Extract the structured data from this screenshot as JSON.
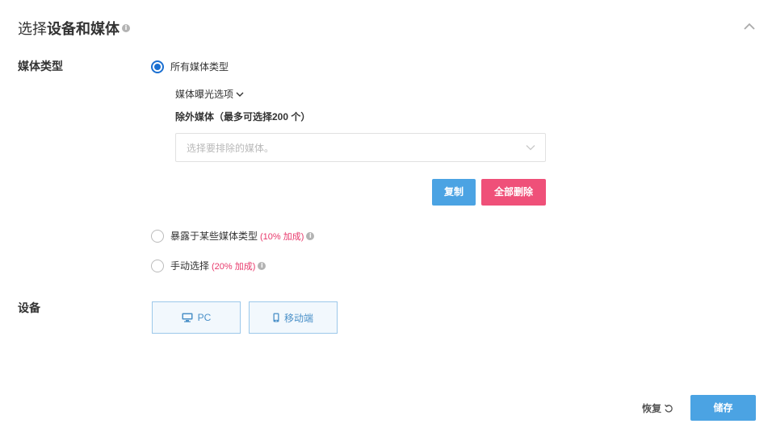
{
  "header": {
    "title_prefix": "选择",
    "title_bold": "设备和媒体",
    "info_icon": "info-icon",
    "collapse_icon": "chevron-up-icon"
  },
  "media_type": {
    "label": "媒体类型",
    "options": [
      {
        "label": "所有媒体类型",
        "checked": true,
        "surcharge": ""
      },
      {
        "label": "暴露于某些媒体类型",
        "checked": false,
        "surcharge": "(10% 加成)"
      },
      {
        "label": "手动选择",
        "checked": false,
        "surcharge": "(20% 加成)"
      }
    ],
    "exposure_options_label": "媒体曝光选项",
    "exclude": {
      "title": "除外媒体（最多可选择200 个）",
      "placeholder": "选择要排除的媒体。"
    },
    "copy_button": "复制",
    "delete_all_button": "全部删除"
  },
  "devices": {
    "label": "设备",
    "items": [
      {
        "label": "PC",
        "icon": "monitor-icon"
      },
      {
        "label": "移动端",
        "icon": "mobile-icon"
      }
    ]
  },
  "footer": {
    "restore_label": "恢复",
    "restore_icon": "undo-icon",
    "save_label": "储存"
  },
  "colors": {
    "accent": "#4ba3e3",
    "radio_selected": "#1a6fd1",
    "danger": "#ef5079",
    "surcharge_text": "#e8386b"
  }
}
